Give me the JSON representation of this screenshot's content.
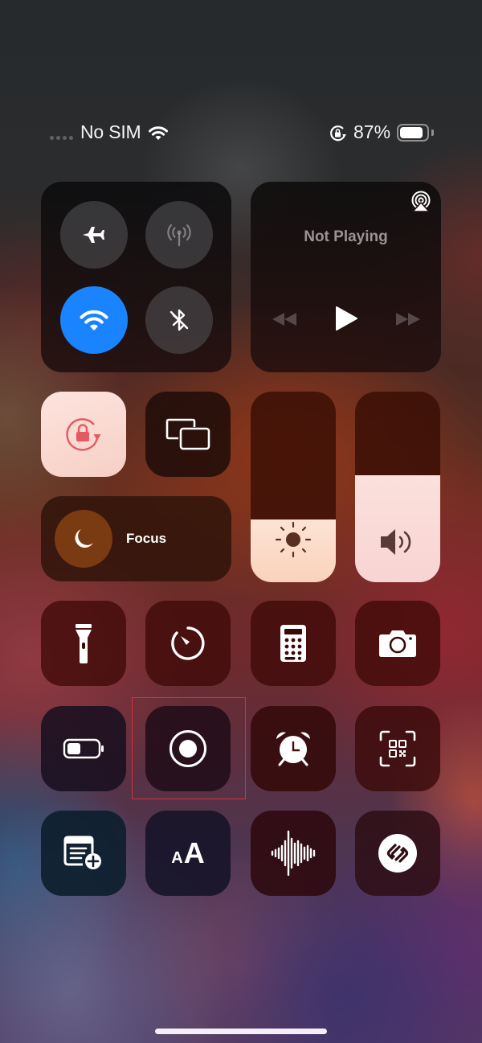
{
  "status_bar": {
    "carrier": "No SIM",
    "signal": "no-service",
    "wifi_connected": true,
    "orientation_lock_icon": "rotation-lock-icon",
    "battery_percent_label": "87%",
    "battery_level": 0.87
  },
  "connectivity": {
    "airplane_mode": {
      "icon": "airplane-icon",
      "enabled": false
    },
    "cellular_data": {
      "icon": "antenna-icon",
      "enabled": false
    },
    "wifi": {
      "icon": "wifi-icon",
      "enabled": true
    },
    "bluetooth": {
      "icon": "bluetooth-off-icon",
      "enabled": false
    }
  },
  "media": {
    "status": "Not Playing",
    "airplay_icon": "airplay-icon",
    "controls": [
      "rewind",
      "play",
      "fast-forward"
    ]
  },
  "controls": {
    "orientation_lock": {
      "icon": "rotation-lock-icon",
      "enabled": true
    },
    "screen_mirroring": {
      "icon": "screen-mirroring-icon"
    },
    "focus": {
      "label": "Focus",
      "icon": "moon-icon"
    },
    "brightness": {
      "icon": "sun-icon",
      "level": 0.33
    },
    "volume": {
      "icon": "speaker-icon",
      "level": 0.56
    }
  },
  "grid": [
    {
      "name": "flashlight",
      "icon": "flashlight-icon"
    },
    {
      "name": "timer",
      "icon": "timer-icon"
    },
    {
      "name": "calculator",
      "icon": "calculator-icon"
    },
    {
      "name": "camera",
      "icon": "camera-icon"
    },
    {
      "name": "low-power-mode",
      "icon": "battery-icon"
    },
    {
      "name": "screen-recording",
      "icon": "record-icon",
      "highlighted": true
    },
    {
      "name": "alarm",
      "icon": "alarm-clock-icon"
    },
    {
      "name": "code-scanner",
      "icon": "qr-code-icon"
    },
    {
      "name": "quick-note",
      "icon": "note-add-icon"
    },
    {
      "name": "text-size",
      "icon": "text-size-icon",
      "small_glyph": "A",
      "big_glyph": "A"
    },
    {
      "name": "sound-recognition",
      "icon": "waveform-icon"
    },
    {
      "name": "music-recognition",
      "icon": "shazam-icon"
    }
  ],
  "accent_colors": {
    "wifi_active": "#1a84ff",
    "rotation_lock_tint": "#e45a62",
    "highlight_box": "#d8303a"
  }
}
